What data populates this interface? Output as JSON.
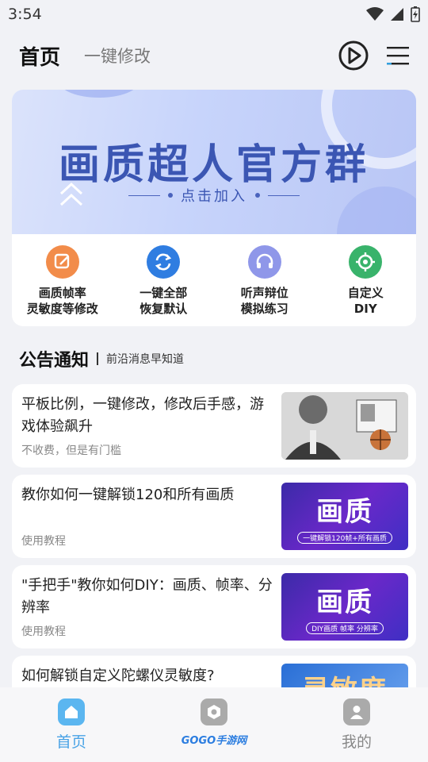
{
  "status": {
    "time": "3:54"
  },
  "header": {
    "title": "首页",
    "tab": "一键修改",
    "icons": [
      "play-circle-icon",
      "menu-icon"
    ]
  },
  "banner": {
    "title": "画质超人官方群",
    "subtitle": "点击加入"
  },
  "quick_actions": [
    {
      "line1": "画质帧率",
      "line2": "灵敏度等修改",
      "icon": "edit-icon",
      "color": "#f28c4a"
    },
    {
      "line1": "一键全部",
      "line2": "恢复默认",
      "icon": "refresh-icon",
      "color": "#2f7de1"
    },
    {
      "line1": "听声辩位",
      "line2": "模拟练习",
      "icon": "headset-icon",
      "color": "#8f97e9"
    },
    {
      "line1": "自定义",
      "line2": "DIY",
      "icon": "target-icon",
      "color": "#39b36b"
    }
  ],
  "announcements": {
    "title": "公告通知",
    "subtitle": "前沿消息早知道"
  },
  "news": [
    {
      "title": "平板比例，一键修改，修改后手感，游戏体验飙升",
      "meta": "不收费，但是有门槛",
      "thumb_text": "",
      "thumb_sub": ""
    },
    {
      "title": "教你如何一键解锁120和所有画质",
      "meta": "使用教程",
      "thumb_text": "画质",
      "thumb_sub": "一键解锁120帧+所有画质"
    },
    {
      "title": "\"手把手\"教你如何DIY：画质、帧率、分辨率",
      "meta": "使用教程",
      "thumb_text": "画质",
      "thumb_sub": "DIY画质 帧率 分辨率"
    },
    {
      "title": "如何解锁自定义陀螺仪灵敏度?",
      "meta": "",
      "thumb_text": "灵敏度",
      "thumb_sub": ""
    }
  ],
  "tabbar": [
    {
      "label": "首页",
      "icon": "home-icon",
      "active": true
    },
    {
      "label": "",
      "icon": "hexagon-icon",
      "active": false
    },
    {
      "label": "我的",
      "icon": "user-icon",
      "active": false
    }
  ],
  "watermark": "GOGO手游网",
  "colors": {
    "accent": "#3b56b3",
    "tab_active": "#4aa3e6"
  }
}
